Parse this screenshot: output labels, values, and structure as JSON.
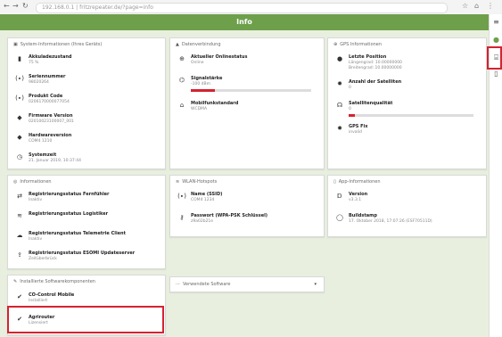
{
  "browser": {
    "url": "192.168.0.1 | fritzrepeater.de/?page=info",
    "back": "←",
    "forward": "→",
    "reload": "↻",
    "home": "⌂",
    "star": "☆",
    "menu": "⋮"
  },
  "appbar": {
    "title": "Info"
  },
  "system": {
    "title": "System-Informationen (Ihres Geräts)",
    "items": [
      {
        "label": "Akkuladezustand",
        "value": "75 %",
        "icon": "battery-icon"
      },
      {
        "label": "Seriennummer",
        "value": "98020264",
        "icon": "serial-icon"
      },
      {
        "label": "Produkt Code",
        "value": "0206170000077054",
        "icon": "barcode-icon"
      },
      {
        "label": "Firmware Version",
        "value": "02010023100007_001",
        "icon": "tag-icon"
      },
      {
        "label": "Hardwareversion",
        "value": "COM4 1210",
        "icon": "tag-icon"
      },
      {
        "label": "Systemzeit",
        "value": "21. Januar 2019, 10:37:44",
        "icon": "clock-icon"
      }
    ]
  },
  "mobile": {
    "title": "Datenverbindung",
    "items": [
      {
        "label": "Aktueller Onlinestatus",
        "value": "Online",
        "icon": "globe-icon"
      },
      {
        "label": "Signalstärke",
        "value": "-100 dBm",
        "icon": "signal-icon",
        "level": 0.2
      },
      {
        "label": "Mobilfunkstandard",
        "value": "WCDMA",
        "icon": "cell-icon"
      }
    ]
  },
  "gps": {
    "title": "GPS Informationen",
    "items": [
      {
        "label": "Letzte Position",
        "value": "Längengrad: 10.00000000",
        "value2": "Breitengrad: 10.00000000",
        "icon": "pin-icon"
      },
      {
        "label": "Anzahl der Satelliten",
        "value": "0",
        "icon": "satellite-icon"
      },
      {
        "label": "Satellitenqualität",
        "value": "0",
        "icon": "quality-icon",
        "level": 0.05
      },
      {
        "label": "GPS Fix",
        "value": "invalid",
        "icon": "fix-icon"
      }
    ]
  },
  "registration": {
    "title": "Informationen",
    "items": [
      {
        "label": "Registrierungsstatus Fernfühler",
        "value": "Inaktiv",
        "icon": "link-icon"
      },
      {
        "label": "Registrierungsstatus Logistiker",
        "value": "",
        "icon": "wifi-icon"
      },
      {
        "label": "Registrierungsstatus Telemetrie Client",
        "value": "Inaktiv",
        "icon": "cloud-icon"
      },
      {
        "label": "Registrierungsstatus ESOMI Updateserver",
        "value": "Zeitüberbrück",
        "icon": "upload-icon"
      }
    ]
  },
  "wlan": {
    "title": "WLAN-Hotspots",
    "items": [
      {
        "label": "Name (SSID)",
        "value": "COM4 1234",
        "icon": "wifi-icon"
      },
      {
        "label": "Passwort (WPA-PSK Schlüssel)",
        "value": "z9a02b21e",
        "icon": "key-icon"
      }
    ]
  },
  "app": {
    "title": "App-Informationen",
    "items": [
      {
        "label": "Version",
        "value": "v3.3.1",
        "icon": "info-icon"
      },
      {
        "label": "Buildstamp",
        "value": "17. Oktober 2018, 17:07:26 (ESF70511D)",
        "icon": "build-icon"
      }
    ]
  },
  "software": {
    "title": "Installierte Softwarekomponenten",
    "items": [
      {
        "label": "CO-Control Mobile",
        "value": "Installiert",
        "icon": "check-icon"
      },
      {
        "label": "Agrirouter",
        "value": "Lizensiert",
        "icon": "check-icon"
      }
    ]
  },
  "versions": {
    "title": "Verwendete Software",
    "chevron": "▾"
  },
  "colors": {
    "primary": "#6ea04c",
    "highlight": "#d42330",
    "background": "#e8efdf"
  }
}
